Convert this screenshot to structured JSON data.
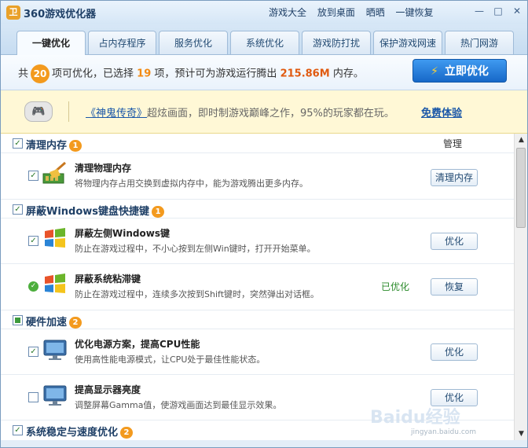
{
  "app": {
    "logo": "卫",
    "title": "360游戏优化器"
  },
  "toplinks": [
    "游戏大全",
    "放到桌面",
    "晒晒",
    "一键恢复"
  ],
  "window": {
    "minimize": "—",
    "maximize": "□",
    "close": "✕"
  },
  "tabs": [
    "一键优化",
    "占内存程序",
    "服务优化",
    "系统优化",
    "游戏防打扰",
    "保护游戏网速",
    "热门网游"
  ],
  "summary": {
    "prefix": "共",
    "total": "20",
    "mid1": "项可优化，已选择",
    "selected": "19",
    "mid2": "项，预计可为游戏运行腾出",
    "memory": "215.86M",
    "suffix": "内存。",
    "button": "立即优化"
  },
  "ad": {
    "game": "《神鬼传奇》",
    "text": "超炫画面，即时制游戏巅峰之作，95%的玩家都在玩。",
    "cta": "免费体验"
  },
  "manage_label": "管理",
  "sections": [
    {
      "title": "清理内存",
      "count": "1",
      "items": [
        {
          "title": "清理物理内存",
          "desc": "将物理内存占用交换到虚拟内存中，能为游戏腾出更多内存。",
          "action": "清理内存",
          "status": ""
        }
      ]
    },
    {
      "title": "屏蔽Windows键盘快捷键",
      "count": "1",
      "items": [
        {
          "title": "屏蔽左侧Windows键",
          "desc": "防止在游戏过程中，不小心按到左侧Win键时，打开开始菜单。",
          "action": "优化",
          "status": ""
        },
        {
          "title": "屏蔽系统粘滞键",
          "desc": "防止在游戏过程中，连续多次按到Shift键时，突然弹出对话框。",
          "action": "恢复",
          "status": "已优化"
        }
      ]
    },
    {
      "title": "硬件加速",
      "count": "2",
      "items": [
        {
          "title": "优化电源方案，提高CPU性能",
          "desc": "使用高性能电源模式，让CPU处于最佳性能状态。",
          "action": "优化",
          "status": ""
        },
        {
          "title": "提高显示器亮度",
          "desc": "调整屏幕Gamma值，使游戏画面达到最佳显示效果。",
          "action": "优化",
          "status": ""
        }
      ]
    },
    {
      "title": "系统稳定与速度优化",
      "count": "2",
      "items": []
    }
  ],
  "watermark": {
    "main": "Baidu经验",
    "sub": "jingyan.baidu.com"
  },
  "colors": {
    "accent": "#1768c8",
    "orange": "#f39a1e",
    "ok": "#2a8a2a"
  }
}
